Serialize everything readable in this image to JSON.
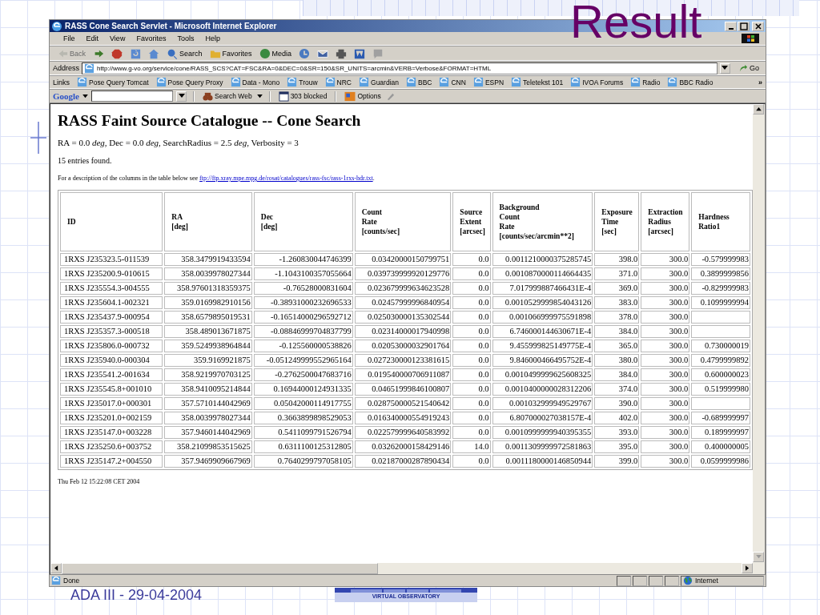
{
  "slide": {
    "title": "Result",
    "footer": "ADA III - 29-04-2004",
    "logo_caption": "VIRTUAL OBSERVATORY"
  },
  "window": {
    "title": "RASS Cone Search Servlet - Microsoft Internet Explorer"
  },
  "menu": [
    "File",
    "Edit",
    "View",
    "Favorites",
    "Tools",
    "Help"
  ],
  "toolbar": [
    {
      "kind": "back",
      "label": "Back",
      "disabled": true
    },
    {
      "kind": "forward",
      "disabled": false
    },
    {
      "kind": "stop",
      "disabled": false
    },
    {
      "kind": "refresh",
      "disabled": false
    },
    {
      "kind": "home",
      "disabled": false
    },
    {
      "kind": "search",
      "label": "Search",
      "disabled": false
    },
    {
      "kind": "favorites",
      "label": "Favorites",
      "disabled": false
    },
    {
      "kind": "media",
      "label": "Media",
      "disabled": false
    },
    {
      "kind": "history",
      "disabled": false
    },
    {
      "kind": "mail",
      "disabled": false
    },
    {
      "kind": "print",
      "disabled": false
    },
    {
      "kind": "edit",
      "disabled": false
    },
    {
      "kind": "discuss",
      "disabled": false
    }
  ],
  "address": {
    "label": "Address",
    "value": "http://www.g-vo.org/service/cone/RASS_SCS?CAT=FSC&RA=0&DEC=0&SR=150&SR_UNITS=arcmin&VERB=Verbose&FORMAT=HTML",
    "go": "Go"
  },
  "links": {
    "label": "Links",
    "items": [
      "Pose Query Tomcat",
      "Pose Query Proxy",
      "Data - Mono",
      "Trouw",
      "NRC",
      "Guardian",
      "BBC",
      "CNN",
      "ESPN",
      "Teletekst 101",
      "IVOA Forums",
      "Radio",
      "BBC Radio"
    ],
    "more": "»"
  },
  "google_bar": {
    "logo": "Google",
    "search_button": "Search Web",
    "popups": "303 blocked",
    "options": "Options"
  },
  "page": {
    "heading": "RASS Faint Source Catalogue -- Cone Search",
    "params": "RA = 0.0 *deg*, Dec = 0.0 *deg*, SearchRadius = 2.5 *deg*, Verbosity = 3",
    "count": "15 entries found.",
    "description": "For a description of the columns in the table below see ",
    "link": "ftp://ftp.xray.mpe.mpg.de/rosat/catalogues/rass-fsc/rass-1rxs-hdr.txt",
    "description_end": ".",
    "timestamp": "Thu Feb 12 15:22:08 CET 2004"
  },
  "table": {
    "columns": [
      {
        "lines": [
          "ID"
        ]
      },
      {
        "lines": [
          "RA",
          "[deg]"
        ]
      },
      {
        "lines": [
          "Dec",
          "[deg]"
        ]
      },
      {
        "lines": [
          "Count",
          "Rate",
          "[counts/sec]"
        ]
      },
      {
        "lines": [
          "Source",
          "Extent",
          "[arcsec]"
        ]
      },
      {
        "lines": [
          "Background",
          "Count",
          "Rate",
          "[counts/sec/arcmin**2]"
        ]
      },
      {
        "lines": [
          "Exposure",
          "Time",
          "[sec]"
        ]
      },
      {
        "lines": [
          "Extraction",
          "Radius",
          "[arcsec]"
        ]
      },
      {
        "lines": [
          "Hardness",
          "Ratio1"
        ]
      }
    ],
    "rows": [
      [
        "1RXS J235323.5-011539",
        "358.3479919433594",
        "-1.260830044746399",
        "0.03420000150799751",
        "0.0",
        "0.0011210000375285745",
        "398.0",
        "300.0",
        "-0.579999983"
      ],
      [
        "1RXS J235200.9-010615",
        "358.0039978027344",
        "-1.1043100357055664",
        "0.039739999920129776",
        "0.0",
        "0.0010870000114664435",
        "371.0",
        "300.0",
        "0.3899999856"
      ],
      [
        "1RXS J235554.3-004555",
        "358.97601318359375",
        "-0.76528000831604",
        "0.023679999634623528",
        "0.0",
        "7.017999887466431E-4",
        "369.0",
        "300.0",
        "-0.829999983"
      ],
      [
        "1RXS J235604.1-002321",
        "359.0169982910156",
        "-0.38931000232696533",
        "0.02457999996840954",
        "0.0",
        "0.0010529999854043126",
        "383.0",
        "300.0",
        "0.1099999994"
      ],
      [
        "1RXS J235437.9-000954",
        "358.6579895019531",
        "-0.16514000296592712",
        "0.025030000135302544",
        "0.0",
        "0.001066999975591898",
        "378.0",
        "300.0",
        null
      ],
      [
        "1RXS J235357.3-000518",
        "358.489013671875",
        "-0.08846999704837799",
        "0.02314000017940998",
        "0.0",
        "6.746000144630671E-4",
        "384.0",
        "300.0",
        null
      ],
      [
        "1RXS J235806.0-000732",
        "359.5249938964844",
        "-0.125560000538826",
        "0.02053000032901764",
        "0.0",
        "9.455999825149775E-4",
        "365.0",
        "300.0",
        "0.730000019"
      ],
      [
        "1RXS J235940.0-000304",
        "359.9169921875",
        "-0.051249999552965164",
        "0.027230000123381615",
        "0.0",
        "9.846000466495752E-4",
        "380.0",
        "300.0",
        "0.4799999892"
      ],
      [
        "1RXS J235541.2-001634",
        "358.9219970703125",
        "-0.2762500047683716",
        "0.019540000706911087",
        "0.0",
        "0.0010499999625608325",
        "384.0",
        "300.0",
        "0.600000023"
      ],
      [
        "1RXS J235545.8+001010",
        "358.9410095214844",
        "0.16944000124931335",
        "0.04651999846100807",
        "0.0",
        "0.0010400000028312206",
        "374.0",
        "300.0",
        "0.519999980"
      ],
      [
        "1RXS J235017.0+000301",
        "357.5710144042969",
        "0.05042000114917755",
        "0.028750000521540642",
        "0.0",
        "0.001032999949529767",
        "390.0",
        "300.0",
        null
      ],
      [
        "1RXS J235201.0+002159",
        "358.0039978027344",
        "0.3663899898529053",
        "0.016340000554919243",
        "0.0",
        "6.807000027038157E-4",
        "402.0",
        "300.0",
        "-0.689999997"
      ],
      [
        "1RXS J235147.0+003228",
        "357.9460144042969",
        "0.5411099791526794",
        "0.022579999640583992",
        "0.0",
        "0.0010999999940395355",
        "393.0",
        "300.0",
        "0.189999997"
      ],
      [
        "1RXS J235250.6+003752",
        "358.21099853515625",
        "0.6311100125312805",
        "0.03262000158429146",
        "14.0",
        "0.0011309999972581863",
        "395.0",
        "300.0",
        "0.400000005"
      ],
      [
        "1RXS J235147.2+004550",
        "357.9469909667969",
        "0.7640299797058105",
        "0.02187000287890434",
        "0.0",
        "0.0011180000146850944",
        "399.0",
        "300.0",
        "0.0599999986"
      ]
    ]
  },
  "status_bar": {
    "text": "Done",
    "zone": "Internet"
  }
}
